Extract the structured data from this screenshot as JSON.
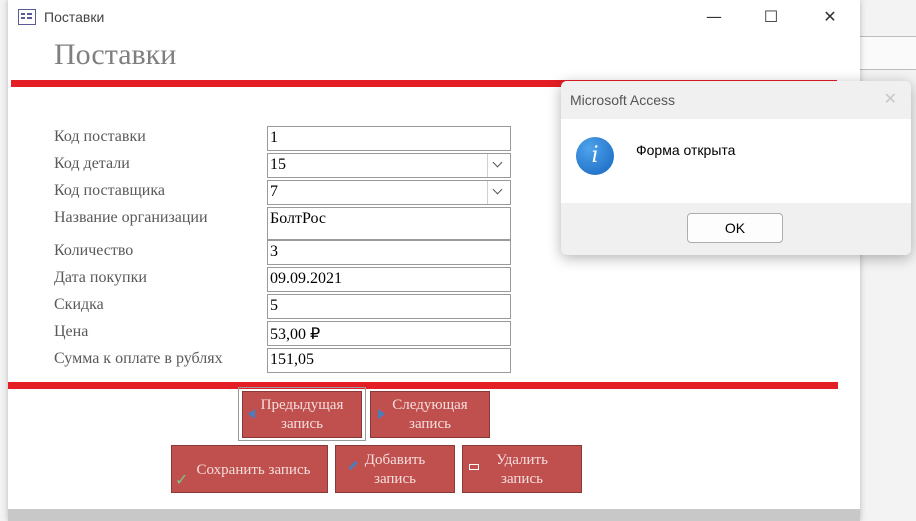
{
  "window": {
    "title": "Поставки",
    "controls": {
      "minimize": "—",
      "maximize": "☐",
      "close": "✕"
    }
  },
  "form": {
    "heading": "Поставки",
    "fields": [
      {
        "label": "Код поставки",
        "value": "1"
      },
      {
        "label": "Код детали",
        "value": "15"
      },
      {
        "label": "Код поставщика",
        "value": "7"
      },
      {
        "label": "Название организации",
        "value": "БолтРос"
      },
      {
        "label": "Количество",
        "value": "3"
      },
      {
        "label": "Дата покупки",
        "value": "09.09.2021"
      },
      {
        "label": "Скидка",
        "value": "5"
      },
      {
        "label": "Цена",
        "value": "53,00 ₽"
      },
      {
        "label": "Сумма к оплате в рублях",
        "value": "151,05"
      }
    ],
    "buttons": {
      "prev": {
        "line1": "Предыдущая",
        "line2": "запись"
      },
      "next": {
        "line1": "Следующая",
        "line2": "запись"
      },
      "save": {
        "label": "Сохранить запись"
      },
      "add": {
        "line1": "Добавить",
        "line2": "запись"
      },
      "delete": {
        "line1": "Удалить",
        "line2": "запись"
      }
    }
  },
  "dialog": {
    "title": "Microsoft Access",
    "close": "✕",
    "icon": "info-icon",
    "message": "Форма открыта",
    "ok_label": "OK"
  },
  "colors": {
    "accent_red": "#e31e24",
    "button_fill": "#c0504d"
  }
}
